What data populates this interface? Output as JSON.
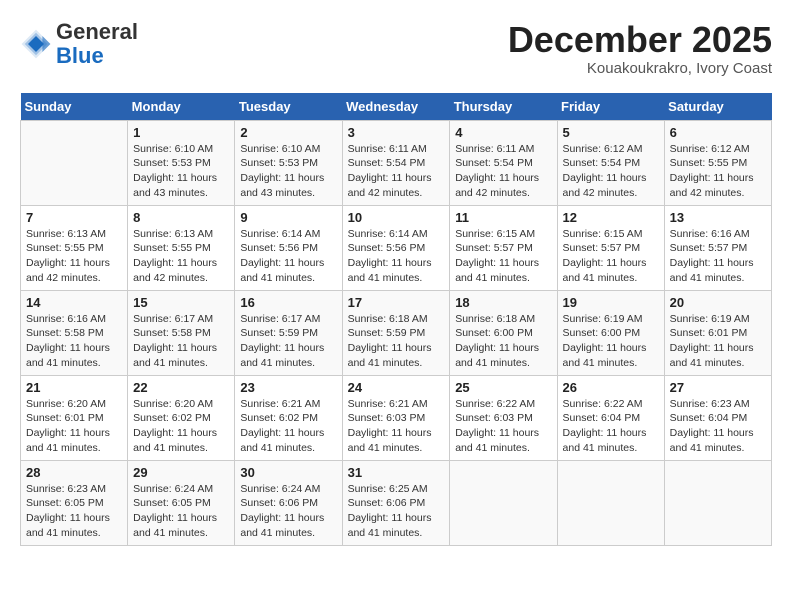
{
  "header": {
    "logo_general": "General",
    "logo_blue": "Blue",
    "month_title": "December 2025",
    "location": "Kouakoukrakro, Ivory Coast"
  },
  "weekdays": [
    "Sunday",
    "Monday",
    "Tuesday",
    "Wednesday",
    "Thursday",
    "Friday",
    "Saturday"
  ],
  "weeks": [
    [
      {
        "day": "",
        "info": ""
      },
      {
        "day": "1",
        "info": "Sunrise: 6:10 AM\nSunset: 5:53 PM\nDaylight: 11 hours\nand 43 minutes."
      },
      {
        "day": "2",
        "info": "Sunrise: 6:10 AM\nSunset: 5:53 PM\nDaylight: 11 hours\nand 43 minutes."
      },
      {
        "day": "3",
        "info": "Sunrise: 6:11 AM\nSunset: 5:54 PM\nDaylight: 11 hours\nand 42 minutes."
      },
      {
        "day": "4",
        "info": "Sunrise: 6:11 AM\nSunset: 5:54 PM\nDaylight: 11 hours\nand 42 minutes."
      },
      {
        "day": "5",
        "info": "Sunrise: 6:12 AM\nSunset: 5:54 PM\nDaylight: 11 hours\nand 42 minutes."
      },
      {
        "day": "6",
        "info": "Sunrise: 6:12 AM\nSunset: 5:55 PM\nDaylight: 11 hours\nand 42 minutes."
      }
    ],
    [
      {
        "day": "7",
        "info": "Sunrise: 6:13 AM\nSunset: 5:55 PM\nDaylight: 11 hours\nand 42 minutes."
      },
      {
        "day": "8",
        "info": "Sunrise: 6:13 AM\nSunset: 5:55 PM\nDaylight: 11 hours\nand 42 minutes."
      },
      {
        "day": "9",
        "info": "Sunrise: 6:14 AM\nSunset: 5:56 PM\nDaylight: 11 hours\nand 41 minutes."
      },
      {
        "day": "10",
        "info": "Sunrise: 6:14 AM\nSunset: 5:56 PM\nDaylight: 11 hours\nand 41 minutes."
      },
      {
        "day": "11",
        "info": "Sunrise: 6:15 AM\nSunset: 5:57 PM\nDaylight: 11 hours\nand 41 minutes."
      },
      {
        "day": "12",
        "info": "Sunrise: 6:15 AM\nSunset: 5:57 PM\nDaylight: 11 hours\nand 41 minutes."
      },
      {
        "day": "13",
        "info": "Sunrise: 6:16 AM\nSunset: 5:57 PM\nDaylight: 11 hours\nand 41 minutes."
      }
    ],
    [
      {
        "day": "14",
        "info": "Sunrise: 6:16 AM\nSunset: 5:58 PM\nDaylight: 11 hours\nand 41 minutes."
      },
      {
        "day": "15",
        "info": "Sunrise: 6:17 AM\nSunset: 5:58 PM\nDaylight: 11 hours\nand 41 minutes."
      },
      {
        "day": "16",
        "info": "Sunrise: 6:17 AM\nSunset: 5:59 PM\nDaylight: 11 hours\nand 41 minutes."
      },
      {
        "day": "17",
        "info": "Sunrise: 6:18 AM\nSunset: 5:59 PM\nDaylight: 11 hours\nand 41 minutes."
      },
      {
        "day": "18",
        "info": "Sunrise: 6:18 AM\nSunset: 6:00 PM\nDaylight: 11 hours\nand 41 minutes."
      },
      {
        "day": "19",
        "info": "Sunrise: 6:19 AM\nSunset: 6:00 PM\nDaylight: 11 hours\nand 41 minutes."
      },
      {
        "day": "20",
        "info": "Sunrise: 6:19 AM\nSunset: 6:01 PM\nDaylight: 11 hours\nand 41 minutes."
      }
    ],
    [
      {
        "day": "21",
        "info": "Sunrise: 6:20 AM\nSunset: 6:01 PM\nDaylight: 11 hours\nand 41 minutes."
      },
      {
        "day": "22",
        "info": "Sunrise: 6:20 AM\nSunset: 6:02 PM\nDaylight: 11 hours\nand 41 minutes."
      },
      {
        "day": "23",
        "info": "Sunrise: 6:21 AM\nSunset: 6:02 PM\nDaylight: 11 hours\nand 41 minutes."
      },
      {
        "day": "24",
        "info": "Sunrise: 6:21 AM\nSunset: 6:03 PM\nDaylight: 11 hours\nand 41 minutes."
      },
      {
        "day": "25",
        "info": "Sunrise: 6:22 AM\nSunset: 6:03 PM\nDaylight: 11 hours\nand 41 minutes."
      },
      {
        "day": "26",
        "info": "Sunrise: 6:22 AM\nSunset: 6:04 PM\nDaylight: 11 hours\nand 41 minutes."
      },
      {
        "day": "27",
        "info": "Sunrise: 6:23 AM\nSunset: 6:04 PM\nDaylight: 11 hours\nand 41 minutes."
      }
    ],
    [
      {
        "day": "28",
        "info": "Sunrise: 6:23 AM\nSunset: 6:05 PM\nDaylight: 11 hours\nand 41 minutes."
      },
      {
        "day": "29",
        "info": "Sunrise: 6:24 AM\nSunset: 6:05 PM\nDaylight: 11 hours\nand 41 minutes."
      },
      {
        "day": "30",
        "info": "Sunrise: 6:24 AM\nSunset: 6:06 PM\nDaylight: 11 hours\nand 41 minutes."
      },
      {
        "day": "31",
        "info": "Sunrise: 6:25 AM\nSunset: 6:06 PM\nDaylight: 11 hours\nand 41 minutes."
      },
      {
        "day": "",
        "info": ""
      },
      {
        "day": "",
        "info": ""
      },
      {
        "day": "",
        "info": ""
      }
    ]
  ]
}
